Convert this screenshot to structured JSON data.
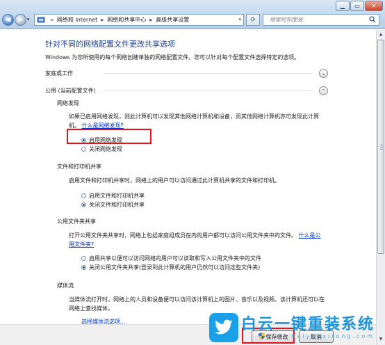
{
  "window": {
    "breadcrumbs": [
      "网络和 Internet",
      "网络和共享中心",
      "高级共享设置"
    ],
    "search_placeholder": "搜索控制面板"
  },
  "page": {
    "heading": "针对不同的网络配置文件更改共享选项",
    "subheading": "Windows 为您所使用的每个网络创建单独的网络配置文件。您可以针对每个配置文件选择特定的选项。"
  },
  "profiles": {
    "home": {
      "label": "家庭或工作"
    },
    "public": {
      "label": "公用 (当前配置文件)"
    }
  },
  "network_discovery": {
    "title": "网络发现",
    "description": "如果已启用网络发现，则此计算机可以发现其他网络计算机和设备，而其他网络计算机亦可发现此计算机。",
    "link": "什么是网络发现?",
    "options": [
      "启用网络发现",
      "关闭网络发现"
    ],
    "selected": 0
  },
  "file_printer_sharing": {
    "title": "文件和打印机共享",
    "description": "启用文件和打印机共享时，网络上的用户可以访问通过此计算机共享的文件和打印机。",
    "options": [
      "启用文件和打印机共享",
      "关闭文件和打印机共享"
    ],
    "selected": 1
  },
  "public_folder_sharing": {
    "title": "公用文件夹共享",
    "description": "打开公用文件夹共享时，网络上包括家庭组成员在内的用户都可以访问公用文件夹中的文件。",
    "link": "什么是公用文件夹?",
    "options": [
      "启用共享以便可以访问网络的用户可以读取和写入公用文件夹中的文件",
      "关闭公用文件夹共享(登录到此计算机的用户仍然可以访问这些文件夹)"
    ],
    "selected": 1
  },
  "media_streaming": {
    "title": "媒体流",
    "description": "当媒体流打开时，网络上的人员和设备便可以访问该计算机上的图片、音乐以及视频。该计算机还可以在网络上查找媒体。",
    "link": "选择媒体流选项..."
  },
  "buttons": {
    "save": "保存修改",
    "cancel": "取消"
  },
  "watermark": {
    "cn": "白云一键重装系统",
    "en": "baiyunxitong.com"
  },
  "colors": {
    "heading": "#1a3e8c",
    "link": "#0033cc",
    "highlight_box": "#e0141b"
  }
}
